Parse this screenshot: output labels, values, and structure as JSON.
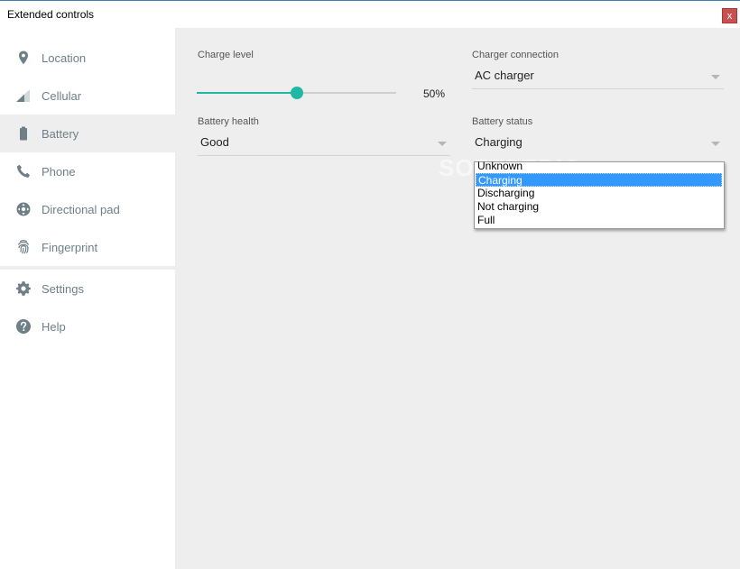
{
  "window": {
    "title": "Extended controls",
    "close_label": "x"
  },
  "sidebar": {
    "items": [
      {
        "label": "Location",
        "icon": "location-pin-icon"
      },
      {
        "label": "Cellular",
        "icon": "cellular-signal-icon"
      },
      {
        "label": "Battery",
        "icon": "battery-icon",
        "active": true
      },
      {
        "label": "Phone",
        "icon": "phone-icon"
      },
      {
        "label": "Directional pad",
        "icon": "dpad-icon"
      },
      {
        "label": "Fingerprint",
        "icon": "fingerprint-icon"
      },
      {
        "label": "Settings",
        "icon": "gear-icon"
      },
      {
        "label": "Help",
        "icon": "help-icon"
      }
    ]
  },
  "battery": {
    "charge_level_label": "Charge level",
    "charge_level_value": "50%",
    "charge_level_fraction": 0.5,
    "charger_connection_label": "Charger connection",
    "charger_connection_value": "AC charger",
    "battery_health_label": "Battery health",
    "battery_health_value": "Good",
    "battery_status_label": "Battery status",
    "battery_status_value": "Charging",
    "status_options": [
      "Unknown",
      "Charging",
      "Discharging",
      "Not charging",
      "Full"
    ],
    "selected_status_index": 1
  },
  "watermark": "SOFTPEDIA",
  "colors": {
    "accent": "#1fb9a3",
    "selection": "#3399ff",
    "sidebar_text": "#6e7f87",
    "close_button": "#c75050"
  }
}
